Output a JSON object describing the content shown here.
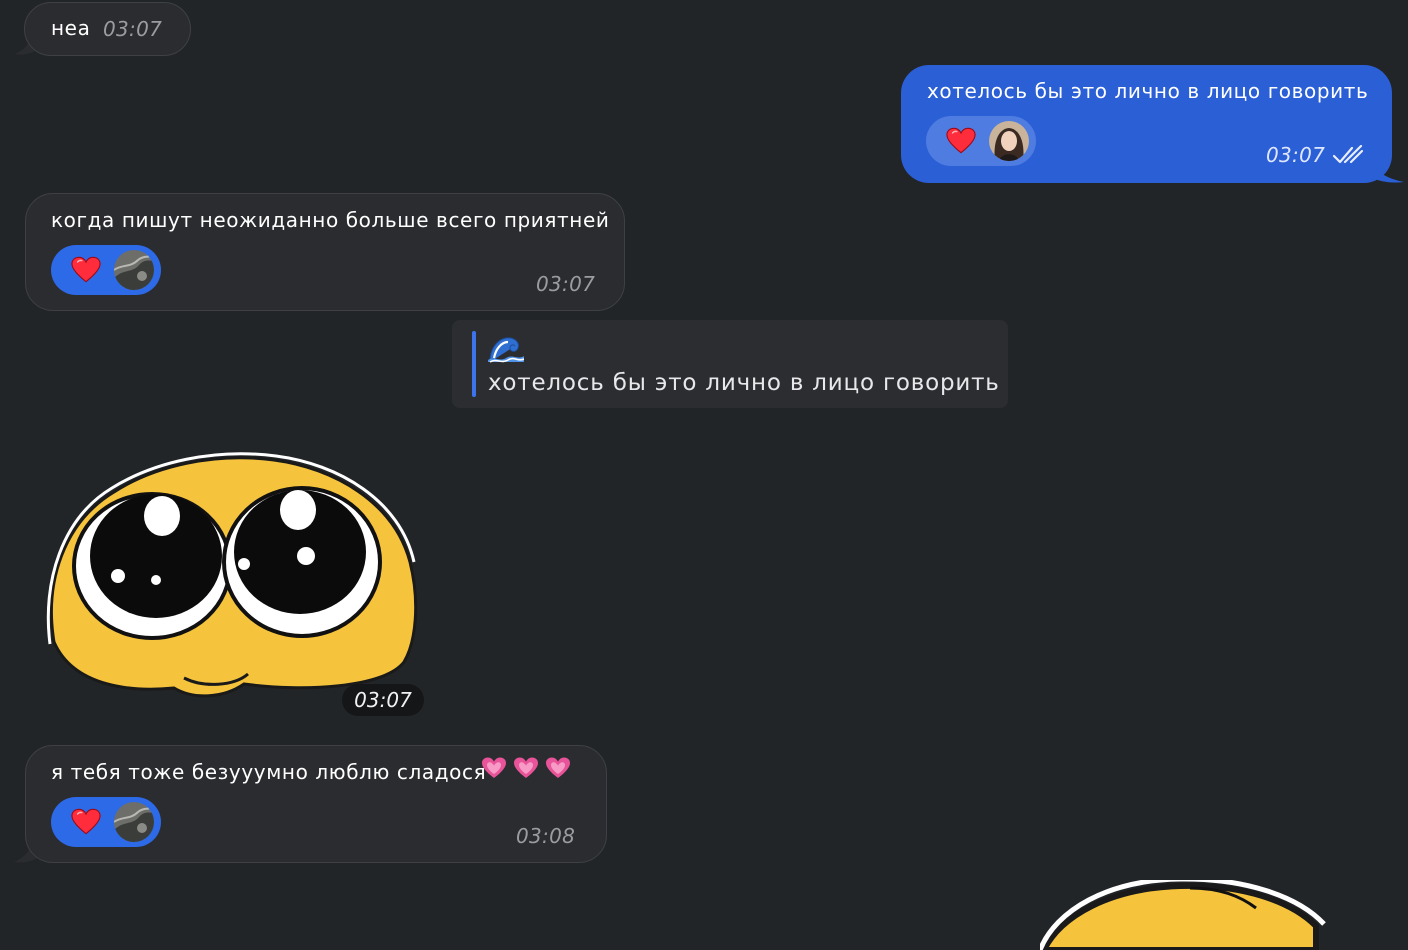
{
  "messages": [
    {
      "id": "m1",
      "direction": "incoming",
      "text": "неа",
      "time": "03:07"
    },
    {
      "id": "m2",
      "direction": "outgoing",
      "text": "хотелось бы это лично в лицо говорить",
      "time": "03:07",
      "reaction": {
        "emoji": "heart-icon",
        "count_avatars": 1
      }
    },
    {
      "id": "m3",
      "direction": "incoming",
      "text": "когда пишут неожиданно больше всего приятней",
      "time": "03:07",
      "reaction": {
        "emoji": "heart-icon",
        "count_avatars": 1
      }
    },
    {
      "id": "m4",
      "direction": "forwarded",
      "emoji": "wave-icon",
      "text": "хотелось бы это лично в лицо говорить"
    },
    {
      "id": "m5",
      "direction": "incoming",
      "type": "sticker",
      "sticker": "pleading-face-sticker",
      "time": "03:07"
    },
    {
      "id": "m6",
      "direction": "incoming",
      "text": "я тебя тоже безууумно люблю сладося",
      "trailing_emojis": [
        "pink-heart-icon",
        "pink-heart-icon",
        "pink-heart-icon"
      ],
      "time": "03:08",
      "reaction": {
        "emoji": "heart-icon",
        "count_avatars": 1
      }
    },
    {
      "id": "m7",
      "direction": "outgoing",
      "type": "sticker",
      "sticker": "pleading-face-sticker"
    }
  ],
  "colors": {
    "background": "#222528",
    "incoming_bubble": "#2b2c2f",
    "outgoing_bubble": "#2b5fd6",
    "reaction_pill": "#2d6ae8",
    "quote_bar": "#3d74ee"
  }
}
